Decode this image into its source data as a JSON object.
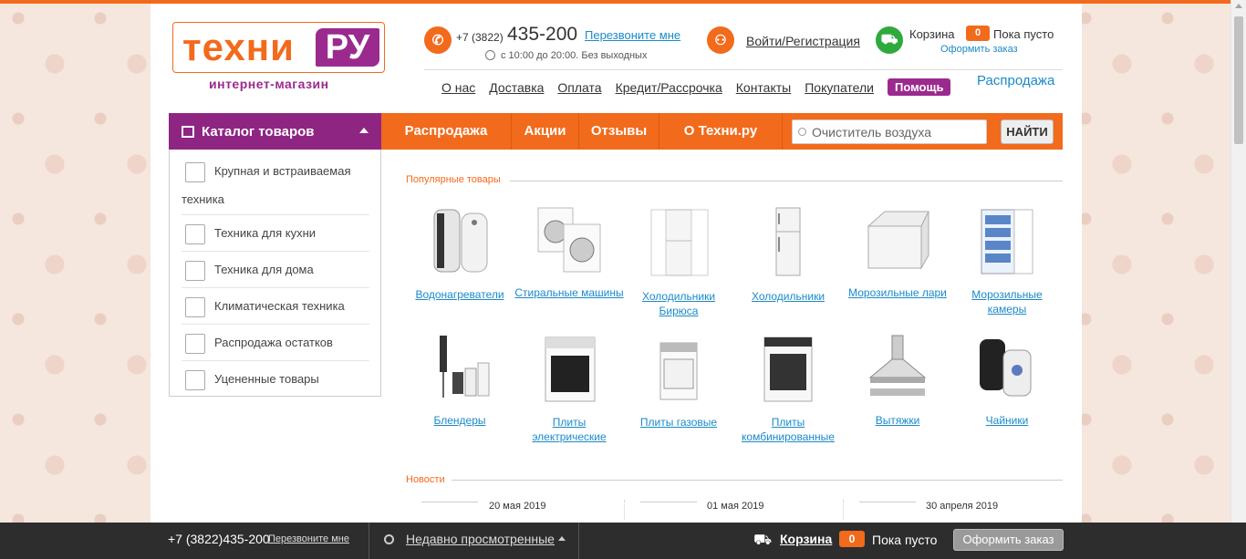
{
  "header": {
    "logo_word": "техни",
    "logo_ru": "РУ",
    "logo_sub": "интернет-магазин",
    "phone_prefix": "+7 (3822)",
    "phone_main": "435-200",
    "callback": "Перезвоните мне",
    "hours": "с 10:00 до 20:00. Без выходных",
    "login": "Войти/Регистрация",
    "cart_label": "Корзина",
    "cart_count": "0",
    "cart_empty": "Пока пусто",
    "cart_order": "Оформить заказ",
    "sale_link": "Распродажа"
  },
  "topnav": [
    "О нас",
    "Доставка",
    "Оплата",
    "Кредит/Рассрочка",
    "Контакты",
    "Покупатели"
  ],
  "help_label": "Помощь",
  "catalog_label": "Каталог товаров",
  "menu": [
    "Распродажа",
    "Акции",
    "Отзывы",
    "О Техни.ру"
  ],
  "search": {
    "value": "Очиститель воздуха",
    "button": "НАЙТИ"
  },
  "sidebar": [
    "Крупная и встраиваемая техника",
    "Техника для кухни",
    "Техника для дома",
    "Климатическая техника",
    "Распродажа остатков",
    "Уцененные товары"
  ],
  "popular_title": "Популярные товары",
  "products_row1": [
    "Водонагреватели",
    "Стиральные машины",
    "Холодильники Бирюса",
    "Холодильники",
    "Морозильные лари",
    "Морозильные камеры"
  ],
  "products_row2": [
    "Блендеры",
    "Плиты электрические",
    "Плиты газовые",
    "Плиты комбинированные",
    "Вытяжки",
    "Чайники"
  ],
  "news_title": "Новости",
  "news_dates": [
    "20 мая 2019",
    "01 мая 2019",
    "30 апреля 2019"
  ],
  "bottom": {
    "phone": "+7 (3822)435-200",
    "callback": "Перезвоните мне",
    "recent": "Недавно просмотренные",
    "cart": "Корзина",
    "count": "0",
    "empty": "Пока пусто",
    "order": "Оформить заказ"
  }
}
